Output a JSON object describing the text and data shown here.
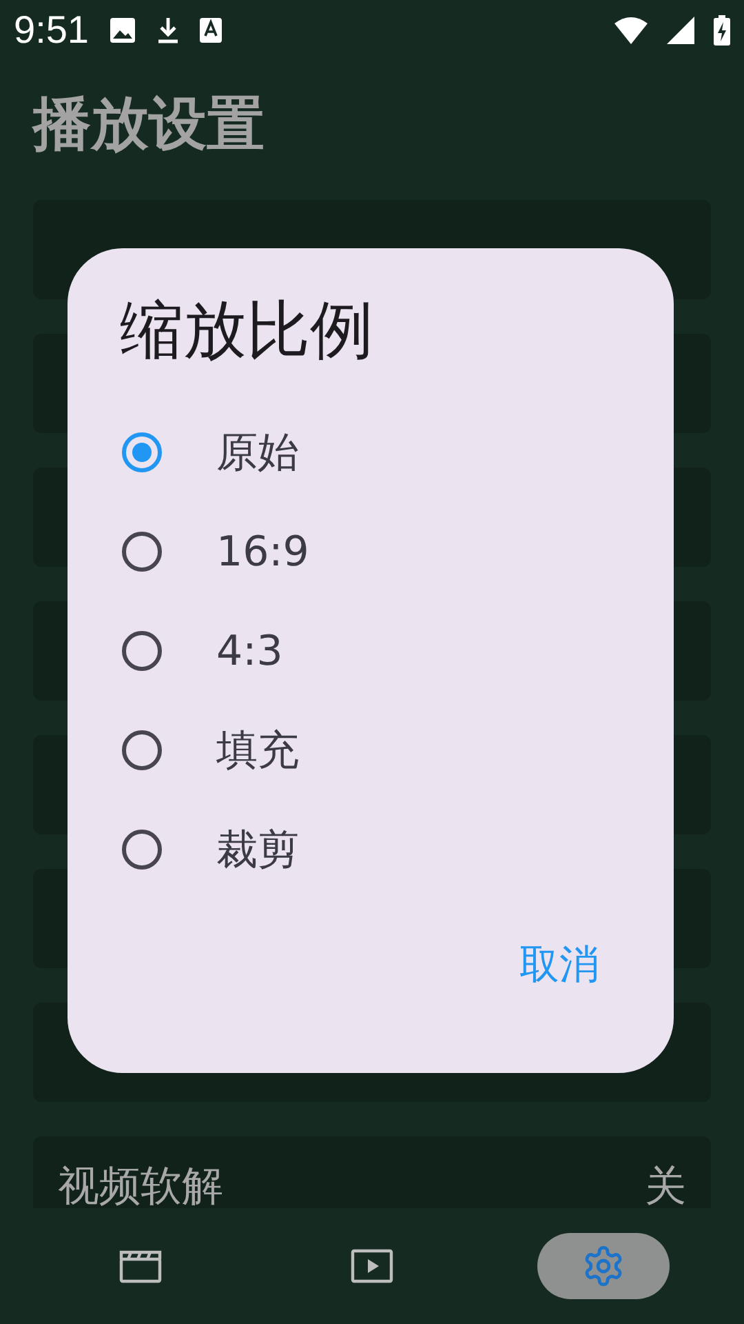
{
  "status_bar": {
    "time": "9:51"
  },
  "title": "播放设置",
  "settings": [
    {
      "label": "视频软解",
      "value": "关"
    }
  ],
  "dialog": {
    "title": "缩放比例",
    "options": [
      {
        "label": "原始",
        "selected": true
      },
      {
        "label": "16:9",
        "selected": false
      },
      {
        "label": "4:3",
        "selected": false
      },
      {
        "label": "填充",
        "selected": false
      },
      {
        "label": "裁剪",
        "selected": false
      }
    ],
    "cancel": "取消"
  },
  "bottom_nav": [
    {
      "kind": "clapper",
      "selected": false
    },
    {
      "kind": "play",
      "selected": false
    },
    {
      "kind": "settings",
      "selected": true
    }
  ]
}
